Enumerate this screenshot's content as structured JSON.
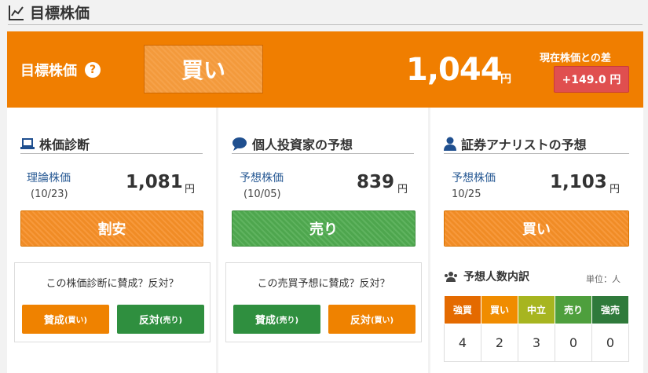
{
  "header": {
    "title": "目標株価"
  },
  "banner": {
    "label": "目標株価",
    "help": "?",
    "judgement": "買い",
    "price": "1,044",
    "price_unit": "円",
    "diff_label": "現在株価との差",
    "diff_value": "+149.0 円"
  },
  "stock_diagnosis": {
    "title": "株価診断",
    "value_label": "理論株価",
    "date": "(10/23)",
    "value": "1,081",
    "unit": "円",
    "judgement": "割安",
    "vote_question": "この株価診断に賛成？反対？",
    "agree_main": "賛成",
    "agree_sub": "(買い)",
    "disagree_main": "反対",
    "disagree_sub": "(売り)"
  },
  "individual_forecast": {
    "title": "個人投資家の予想",
    "value_label": "予想株価",
    "date": "(10/05)",
    "value": "839",
    "unit": "円",
    "judgement": "売り",
    "vote_question": "この売買予想に賛成？反対？",
    "agree_main": "賛成",
    "agree_sub": "(売り)",
    "disagree_main": "反対",
    "disagree_sub": "(買い)"
  },
  "analyst_forecast": {
    "title": "証券アナリストの予想",
    "value_label": "予想株価",
    "date": "10/25",
    "value": "1,103",
    "unit": "円",
    "judgement": "買い",
    "breakdown_title": "予想人数内訳",
    "breakdown_unit": "単位：人",
    "columns": [
      "強買",
      "買い",
      "中立",
      "売り",
      "強売"
    ],
    "counts": [
      "4",
      "2",
      "3",
      "0",
      "0"
    ]
  },
  "colors": {
    "accent_orange": "#f07e00",
    "diff_red": "#e04f4f",
    "strong_buy": "#e46a00",
    "buy": "#f08c00",
    "neutral": "#a7b520",
    "sell": "#4e9f3d",
    "strong_sell": "#2f7a3b"
  }
}
